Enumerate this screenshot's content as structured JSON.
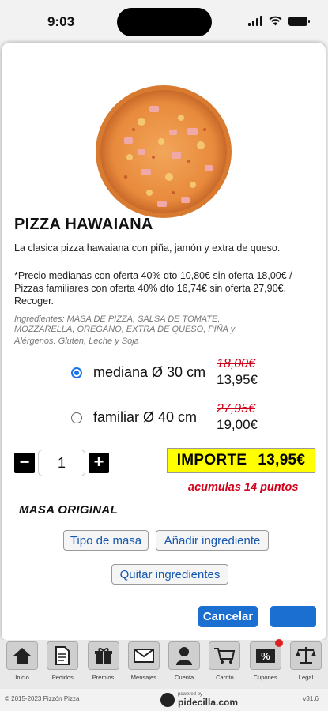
{
  "status_bar": {
    "time": "9:03"
  },
  "product": {
    "name": "PIZZA HAWAIANA",
    "description": "La clasica pizza hawaiana con piña, jamón y extra de queso.",
    "note": "*Precio medianas con oferta 40% dto 10,80€ sin oferta 18,00€ / Pizzas familiares con oferta 40% dto 16,74€ sin oferta 27,90€. Recoger.",
    "ingredients": "Ingredientes: MASA DE PIZZA, SALSA DE TOMATE, MOZZARELLA, OREGANO, EXTRA DE QUESO, PIÑA y",
    "allergens": "Alérgenos: Gluten, Leche y Soja"
  },
  "sizes": [
    {
      "label": "mediana Ø 30 cm",
      "old_price": "18,00€",
      "price": "13,95€",
      "selected": true
    },
    {
      "label": "familiar Ø 40 cm",
      "old_price": "27,95€",
      "price": "19,00€",
      "selected": false
    }
  ],
  "quantity": {
    "minus": "−",
    "value": "1",
    "plus": "+"
  },
  "importe": {
    "label": "IMPORTE",
    "amount": "13,95€"
  },
  "points_text": "acumulas 14 puntos",
  "masa_heading": "MASA ORIGINAL",
  "buttons": {
    "tipo_masa": "Tipo de masa",
    "anadir": "Añadir ingrediente",
    "quitar": "Quitar ingredientes",
    "cancelar": "Cancelar",
    "ok": ""
  },
  "nav": [
    {
      "label": "Inicio",
      "icon": "home-icon"
    },
    {
      "label": "Pedidos",
      "icon": "document-icon"
    },
    {
      "label": "Premios",
      "icon": "gift-icon"
    },
    {
      "label": "Mensajes",
      "icon": "envelope-icon"
    },
    {
      "label": "Cuenta",
      "icon": "user-icon"
    },
    {
      "label": "Carrito",
      "icon": "cart-icon"
    },
    {
      "label": "Cupones",
      "icon": "coupon-icon"
    },
    {
      "label": "Legal",
      "icon": "scales-icon"
    }
  ],
  "footer": {
    "copyright": "© 2015-2023  Pizzón Pizza",
    "powered_by": "powered by",
    "brand": "pidecilla.com",
    "version": "v31.6"
  },
  "colors": {
    "accent": "#1a6fd0",
    "importe_bg": "#ffff00",
    "old_price": "#d0021b",
    "points": "#d0021b"
  }
}
